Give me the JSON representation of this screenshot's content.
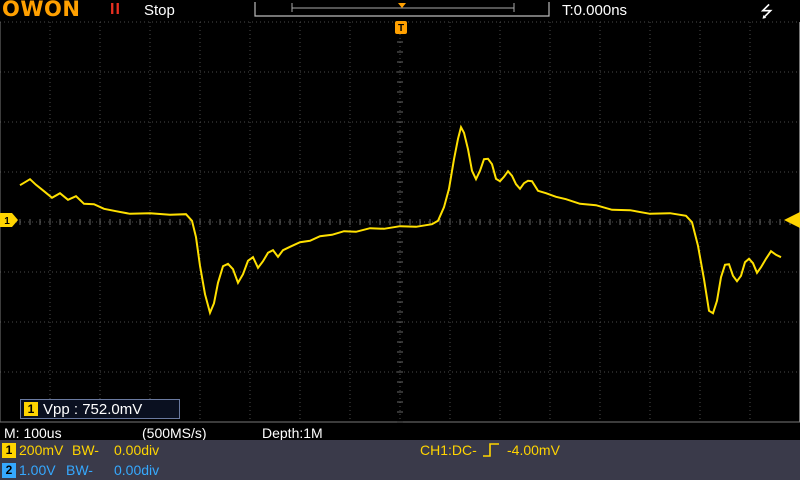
{
  "header": {
    "logo": "OWON",
    "run_state_icon": "II",
    "run_state": "Stop",
    "trigger_position": "T:0.000ns",
    "usb_icon": "usb-icon"
  },
  "trigger_marker": "T",
  "channel1_marker": "1",
  "measurement": {
    "channel": "1",
    "text": "Vpp : 752.0mV"
  },
  "timebase": {
    "main": "M: 100us",
    "sample_rate": "(500MS/s)",
    "depth": "Depth:1M"
  },
  "channels": [
    {
      "id": "1",
      "scale": "200mV",
      "bw": "BW-",
      "offset": "0.00div",
      "color": "#ffd400"
    },
    {
      "id": "2",
      "scale": "1.00V",
      "bw": "BW-",
      "offset": "0.00div",
      "color": "#35a8ff"
    }
  ],
  "trigger": {
    "label": "CH1:DC-",
    "slope_icon": "rising-edge-icon",
    "level": "-4.00mV"
  },
  "colors": {
    "trace": "#ffe000",
    "grid": "#4a4a4a",
    "accent": "#ffa000",
    "ch2": "#35a8ff"
  }
}
